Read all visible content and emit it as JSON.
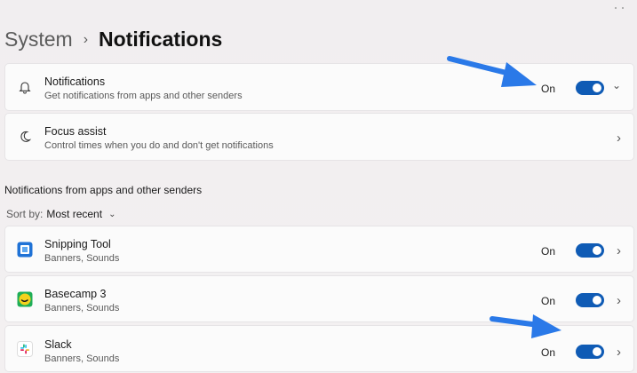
{
  "breadcrumb": {
    "parent": "System",
    "separator": "›",
    "current": "Notifications"
  },
  "notifications": {
    "title": "Notifications",
    "subtitle": "Get notifications from apps and other senders",
    "state": "On",
    "chevron": "⌄"
  },
  "focus_assist": {
    "title": "Focus assist",
    "subtitle": "Control times when you do and don't get notifications",
    "chevron": "›"
  },
  "apps_section": {
    "heading": "Notifications from apps and other senders",
    "sort_label": "Sort by:",
    "sort_value": "Most recent",
    "sort_caret": "⌄"
  },
  "apps": [
    {
      "name": "Snipping Tool",
      "detail": "Banners, Sounds",
      "state": "On",
      "chevron": "›"
    },
    {
      "name": "Basecamp 3",
      "detail": "Banners, Sounds",
      "state": "On",
      "chevron": "›"
    },
    {
      "name": "Slack",
      "detail": "Banners, Sounds",
      "state": "On",
      "chevron": "›"
    }
  ],
  "colors": {
    "accent": "#0f5bb5",
    "arrow": "#2a79e8",
    "background": "#f2eff0",
    "card": "#fbfbfb"
  }
}
